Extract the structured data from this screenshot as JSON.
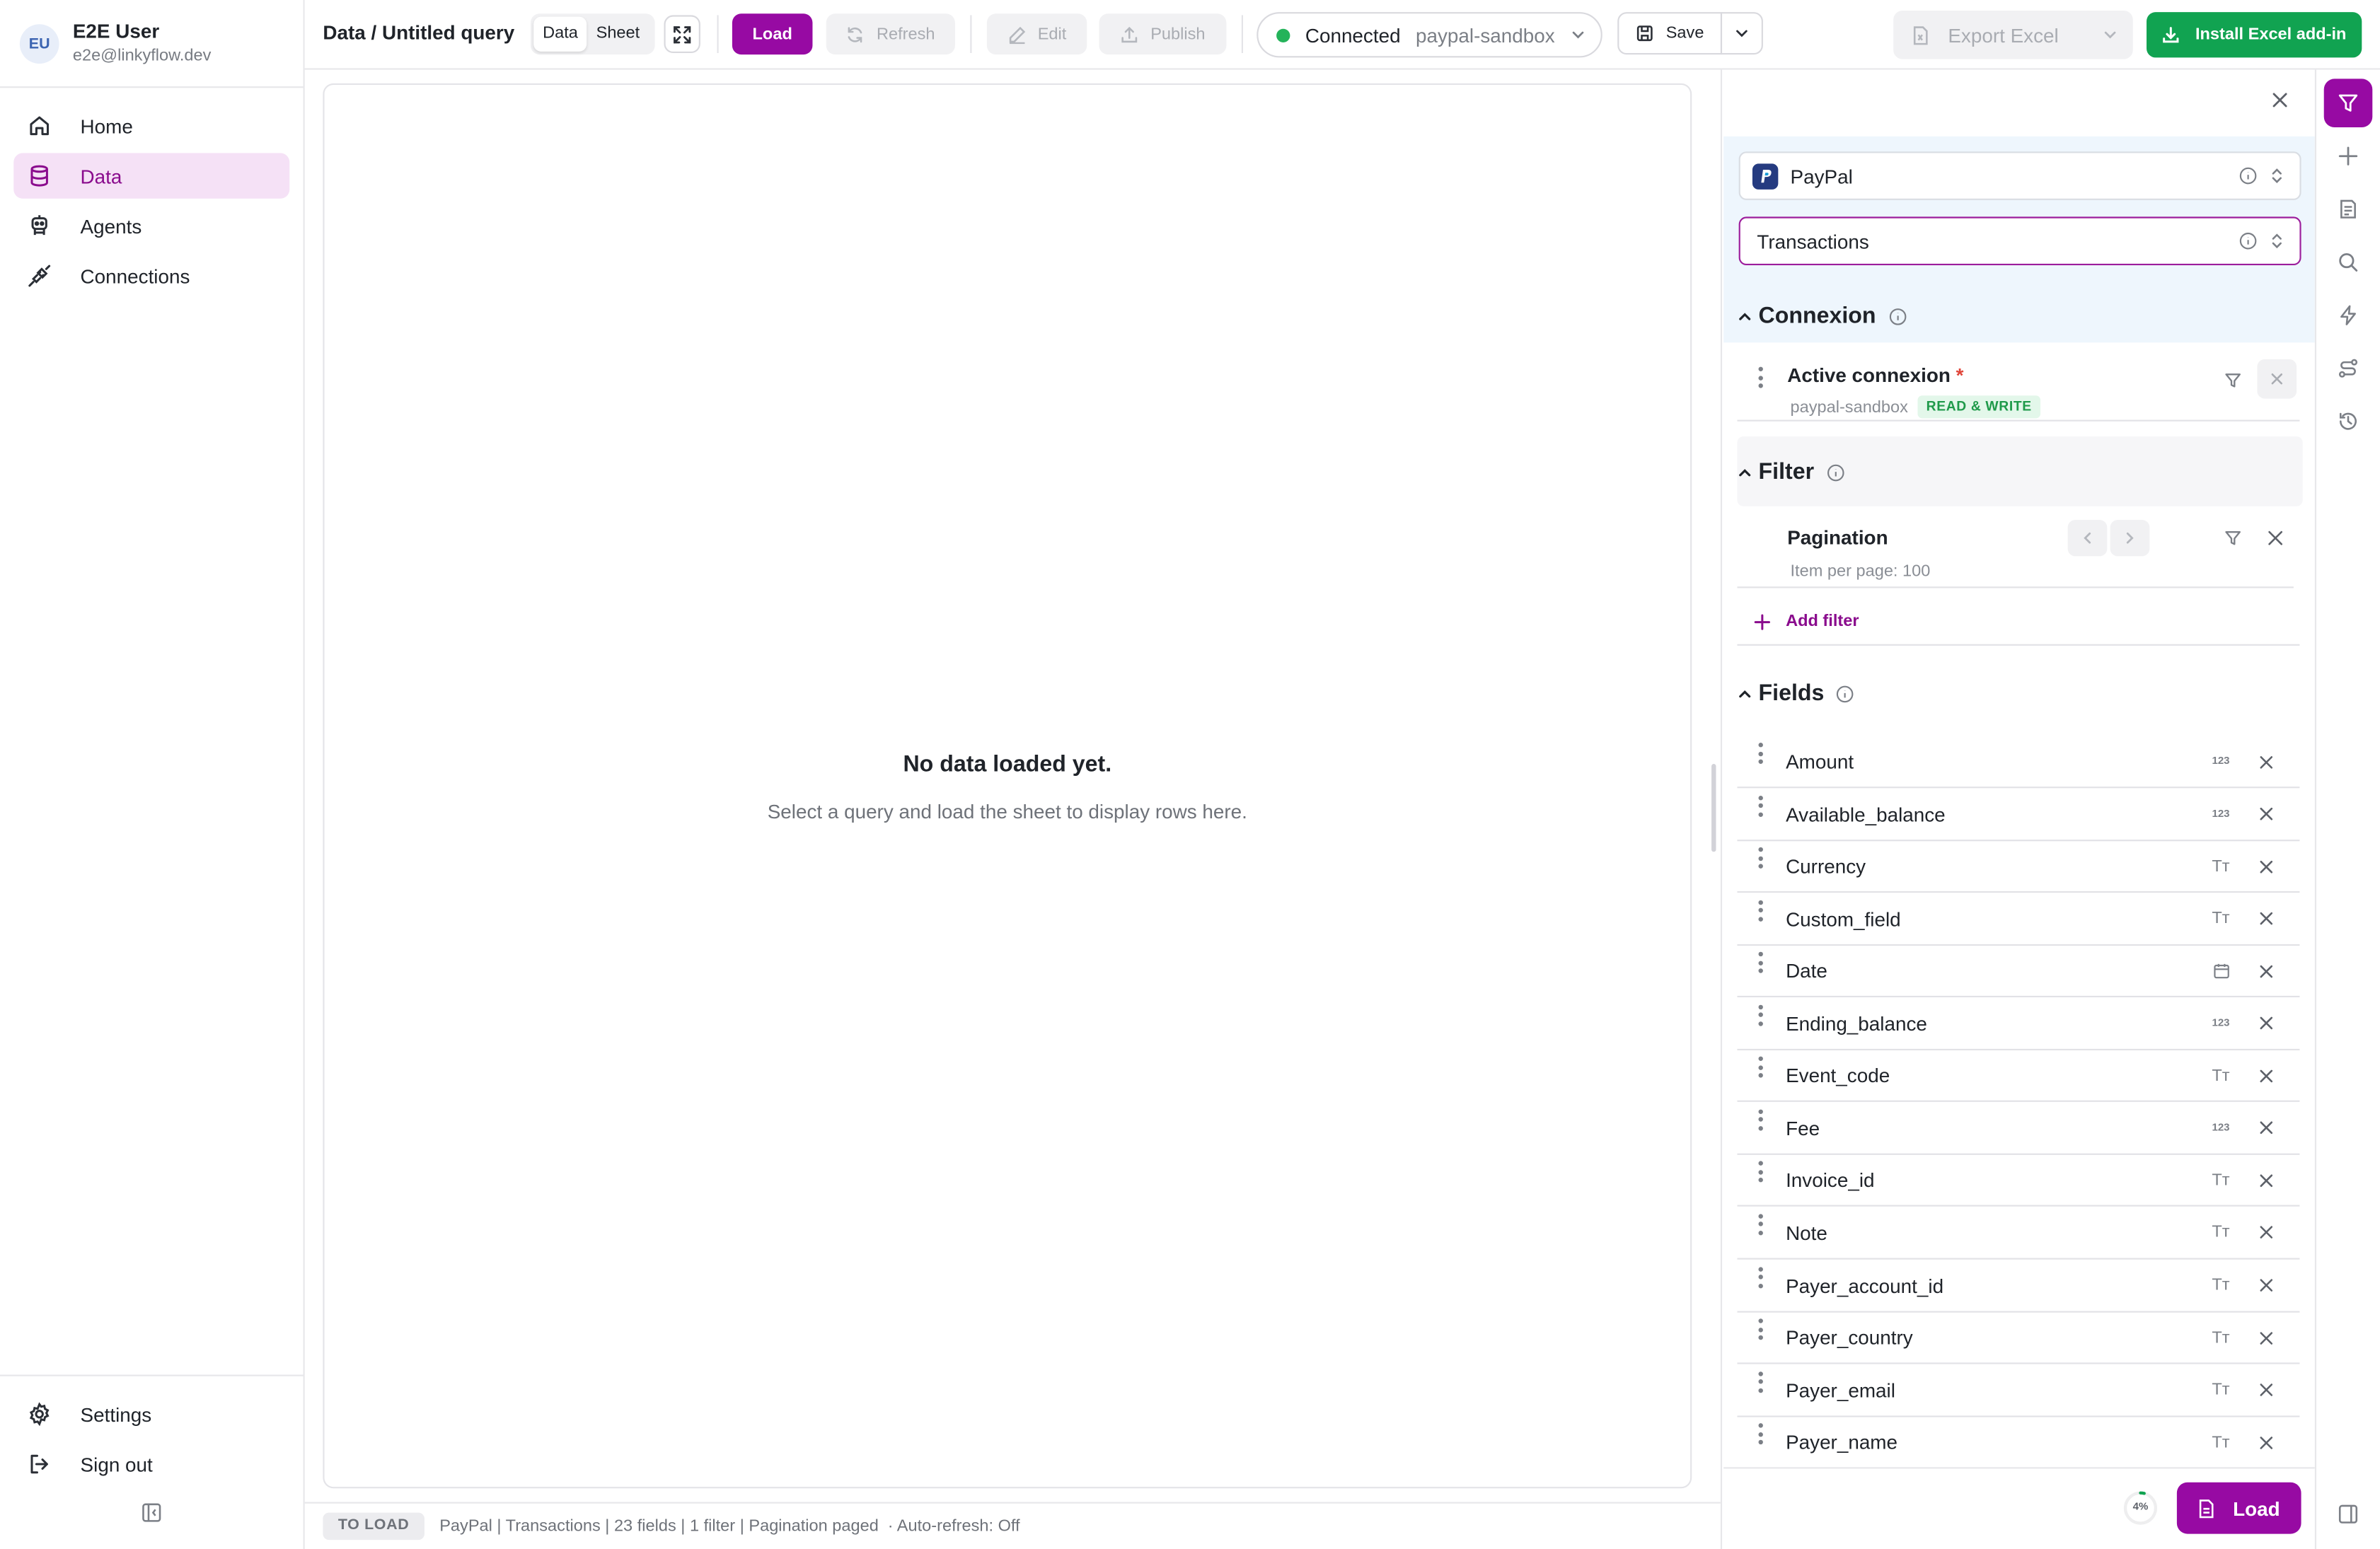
{
  "user": {
    "initials": "EU",
    "name": "E2E User",
    "email": "e2e@linkyflow.dev"
  },
  "nav": {
    "items": [
      {
        "label": "Home",
        "icon": "home-icon"
      },
      {
        "label": "Data",
        "icon": "database-icon",
        "active": true
      },
      {
        "label": "Agents",
        "icon": "agent-icon"
      },
      {
        "label": "Connections",
        "icon": "plug-icon"
      }
    ],
    "bottom": [
      {
        "label": "Settings",
        "icon": "gear-icon"
      },
      {
        "label": "Sign out",
        "icon": "sign-out-icon"
      }
    ]
  },
  "toolbar": {
    "breadcrumb": "Data / Untitled query",
    "view_tabs": [
      "Data",
      "Sheet"
    ],
    "active_tab": "Data",
    "load_label": "Load",
    "refresh_label": "Refresh",
    "edit_label": "Edit",
    "publish_label": "Publish",
    "status_label": "Connected",
    "connection": "paypal-sandbox",
    "save_label": "Save",
    "export_label": "Export Excel",
    "install_label": "Install Excel add-in"
  },
  "main": {
    "empty_title": "No data loaded yet.",
    "empty_subtitle": "Select a query and load the sheet to display rows here."
  },
  "statusbar": {
    "badge": "TO LOAD",
    "summary": "PayPal | Transactions | 23 fields | 1 filter | Pagination paged",
    "autorefresh": "· Auto-refresh: Off"
  },
  "panel": {
    "source": "PayPal",
    "table": "Transactions",
    "connexion": {
      "title": "Connexion",
      "item_label": "Active connexion",
      "required_mark": "*",
      "item_value": "paypal-sandbox",
      "badge": "READ & WRITE"
    },
    "filter": {
      "title": "Filter",
      "item_label": "Pagination",
      "item_value": "Item per page: 100",
      "add_label": "Add filter"
    },
    "fields": {
      "title": "Fields",
      "items": [
        {
          "name": "Amount",
          "type": "number"
        },
        {
          "name": "Available_balance",
          "type": "number"
        },
        {
          "name": "Currency",
          "type": "text"
        },
        {
          "name": "Custom_field",
          "type": "text"
        },
        {
          "name": "Date",
          "type": "date"
        },
        {
          "name": "Ending_balance",
          "type": "number"
        },
        {
          "name": "Event_code",
          "type": "text"
        },
        {
          "name": "Fee",
          "type": "number"
        },
        {
          "name": "Invoice_id",
          "type": "text"
        },
        {
          "name": "Note",
          "type": "text"
        },
        {
          "name": "Payer_account_id",
          "type": "text"
        },
        {
          "name": "Payer_country",
          "type": "text"
        },
        {
          "name": "Payer_email",
          "type": "text"
        },
        {
          "name": "Payer_name",
          "type": "text"
        }
      ]
    },
    "progress_label": "4%",
    "progress": 0.04,
    "load_label": "Load"
  },
  "type_glyphs": {
    "number": "123",
    "text": "Tт"
  },
  "colors": {
    "accent": "#970aa3",
    "accent_light": "#f5e1f6",
    "success": "#11a351",
    "connected_dot": "#24b35a"
  }
}
